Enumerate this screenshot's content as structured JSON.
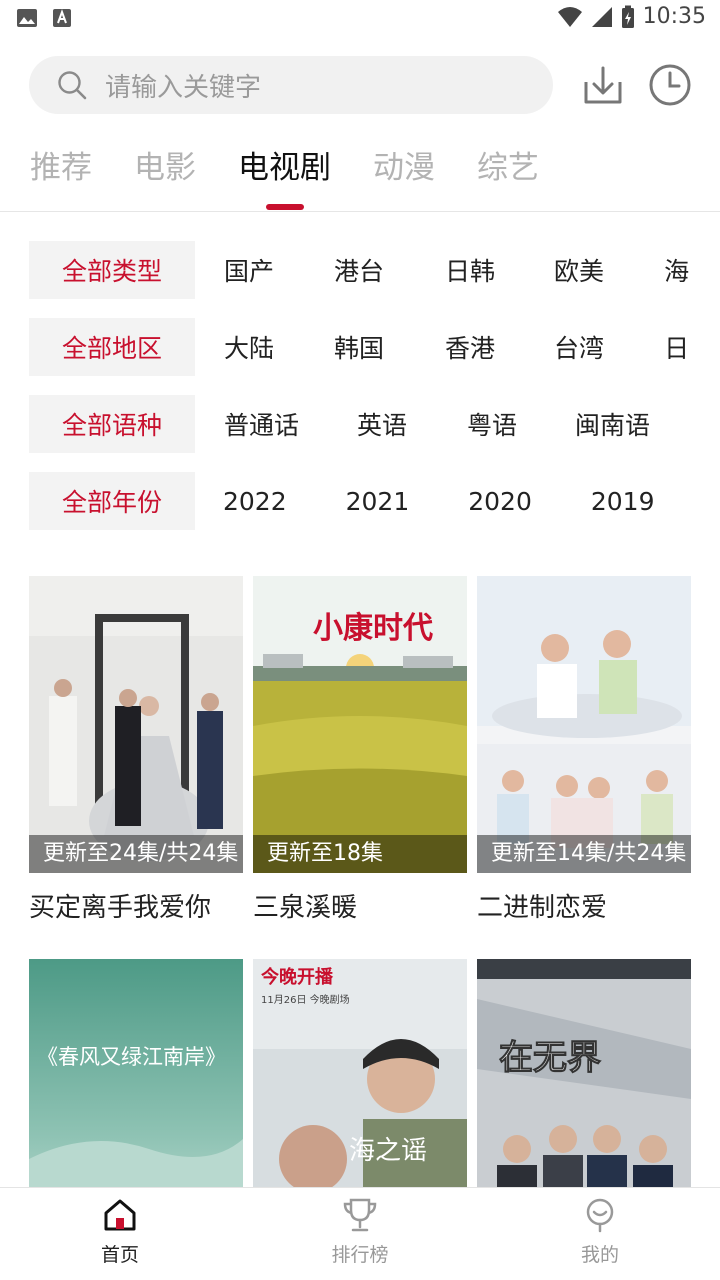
{
  "status_bar": {
    "time": "10:35"
  },
  "search": {
    "placeholder": "请输入关键字"
  },
  "tabs": [
    {
      "label": "推荐"
    },
    {
      "label": "电影"
    },
    {
      "label": "电视剧",
      "active": true
    },
    {
      "label": "动漫"
    },
    {
      "label": "综艺"
    }
  ],
  "filters": {
    "type": {
      "selected": "全部类型",
      "options": [
        "国产",
        "港台",
        "日韩",
        "欧美",
        "海"
      ]
    },
    "region": {
      "selected": "全部地区",
      "options": [
        "大陆",
        "韩国",
        "香港",
        "台湾",
        "日"
      ]
    },
    "language": {
      "selected": "全部语种",
      "options": [
        "普通话",
        "英语",
        "粤语",
        "闽南语"
      ]
    },
    "year": {
      "selected": "全部年份",
      "options": [
        "2022",
        "2021",
        "2020",
        "2019"
      ]
    }
  },
  "shows": [
    {
      "title": "买定离手我爱你",
      "badge": "更新至24集/共24集"
    },
    {
      "title": "三泉溪暖",
      "badge": "更新至18集"
    },
    {
      "title": "二进制恋爱",
      "badge": "更新至14集/共24集"
    },
    {
      "title": "",
      "badge": ""
    },
    {
      "title": "",
      "badge": ""
    },
    {
      "title": "",
      "badge": ""
    }
  ],
  "posters": {
    "p2_title": "小康时代",
    "p4_title": "《春风又绿江南岸》",
    "p5_top": "今晚开播",
    "p5_date": "11月26日 今晚剧场",
    "p5_title": "海之谣",
    "p6_title": "在无界"
  },
  "bottom_nav": [
    {
      "label": "首页",
      "active": true
    },
    {
      "label": "排行榜"
    },
    {
      "label": "我的"
    }
  ],
  "colors": {
    "accent": "#c8102e",
    "chip_bg": "#f3f3f3"
  }
}
